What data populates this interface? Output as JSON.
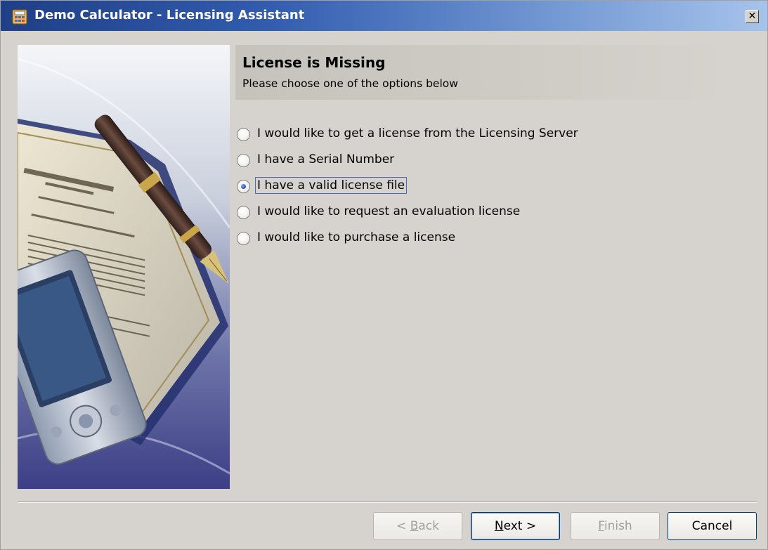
{
  "window": {
    "title": "Demo Calculator - Licensing Assistant",
    "close_glyph": "✕"
  },
  "header": {
    "title": "License is Missing",
    "subtitle": "Please choose one of the options below"
  },
  "options": [
    {
      "label": "I would like to get a license from the Licensing Server",
      "selected": false
    },
    {
      "label": "I have a Serial Number",
      "selected": false
    },
    {
      "label": "I have a valid license file",
      "selected": true
    },
    {
      "label": "I would like to request an evaluation license",
      "selected": false
    },
    {
      "label": "I would like to purchase a license",
      "selected": false
    }
  ],
  "buttons": {
    "back": {
      "pre": "< ",
      "mn": "B",
      "post": "ack",
      "enabled": false
    },
    "next": {
      "pre": "",
      "mn": "N",
      "post": "ext >",
      "enabled": true
    },
    "finish": {
      "pre": "",
      "mn": "F",
      "post": "inish",
      "enabled": false
    },
    "cancel": {
      "label": "Cancel",
      "enabled": true
    }
  },
  "colors": {
    "title_bar_start": "#1f3f86",
    "title_bar_end": "#a6c3eb",
    "dialog_background": "#d6d3ce",
    "radio_selected": "#2b52b8"
  }
}
